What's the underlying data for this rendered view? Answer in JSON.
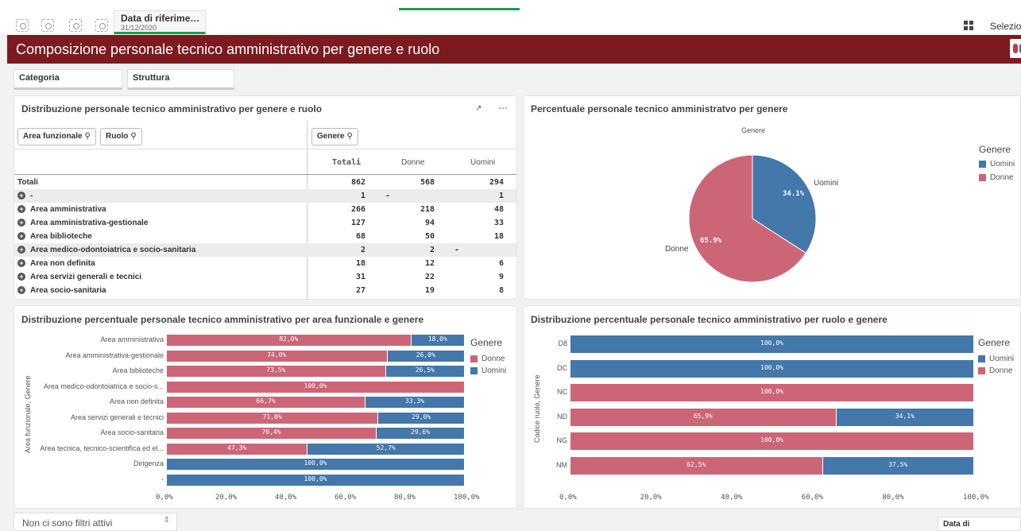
{
  "toolbar": {
    "selection_title": "Data di riferime…",
    "selection_value": "31/12/2020",
    "selections_label": "Selezion"
  },
  "header": {
    "title": "Composizione personale tecnico amministrativo per genere e ruolo"
  },
  "filters": {
    "categoria": "Categoria",
    "struttura": "Struttura"
  },
  "pivot": {
    "title": "Distribuzione personale tecnico amministrativo per genere e ruolo",
    "dim1": "Area funzionale",
    "dim2": "Ruolo",
    "col_dim": "Genere",
    "headers": [
      "Totali",
      "Donne",
      "Uomini"
    ],
    "totals_label": "Totali",
    "totals": [
      "862",
      "568",
      "294"
    ],
    "rows": [
      {
        "label": "-",
        "vals": [
          "1",
          "-",
          "1"
        ]
      },
      {
        "label": "Area amministrativa",
        "vals": [
          "266",
          "218",
          "48"
        ]
      },
      {
        "label": "Area amministrativa-gestionale",
        "vals": [
          "127",
          "94",
          "33"
        ]
      },
      {
        "label": "Area biblioteche",
        "vals": [
          "68",
          "50",
          "18"
        ]
      },
      {
        "label": "Area medico-odontoiatrica e socio-sanitaria",
        "vals": [
          "2",
          "2",
          "-"
        ]
      },
      {
        "label": "Area non definita",
        "vals": [
          "18",
          "12",
          "6"
        ]
      },
      {
        "label": "Area servizi generali e tecnici",
        "vals": [
          "31",
          "22",
          "9"
        ]
      },
      {
        "label": "Area socio-sanitaria",
        "vals": [
          "27",
          "19",
          "8"
        ]
      }
    ]
  },
  "pie": {
    "title": "Percentuale personale tecnico amministratvo per genere",
    "subtitle": "Genere",
    "legend_title": "Genere",
    "legend": [
      "Uomini",
      "Donne"
    ],
    "label_uomini": "Uomini",
    "label_donne": "Donne",
    "pct_uomini": "34.1%",
    "pct_donne": "65.9%"
  },
  "chart_data": [
    {
      "type": "pie",
      "title": "Percentuale personale tecnico amministratvo per genere",
      "slices": [
        {
          "label": "Uomini",
          "value": 34.1,
          "color": "#4477aa"
        },
        {
          "label": "Donne",
          "value": 65.9,
          "color": "#cc6677"
        }
      ]
    },
    {
      "type": "bar",
      "stacked": true,
      "orientation": "horizontal",
      "title": "Distribuzione percentuale personale tecnico amministrativo per area funzionale e genere",
      "ylabel": "Area funzionale, Genere",
      "categories": [
        "Area amministrativa",
        "Area amministrativa-gestionale",
        "Area biblioteche",
        "Area medico-odontoiatrica e socio-s...",
        "Area non definita",
        "Area servizi generali e tecnici",
        "Area socio-sanitaria",
        "Area tecnica, tecnico-scientifica ed el...",
        "Dirigenza",
        "-"
      ],
      "series": [
        {
          "name": "Donne",
          "color": "#cc6677",
          "values": [
            82.0,
            74.0,
            73.5,
            100.0,
            66.7,
            71.0,
            70.4,
            47.3,
            0,
            0
          ]
        },
        {
          "name": "Uomini",
          "color": "#4477aa",
          "values": [
            18.0,
            26.0,
            26.5,
            0,
            33.3,
            29.0,
            29.6,
            52.7,
            100.0,
            100.0
          ]
        }
      ],
      "xlim": [
        0,
        100
      ],
      "ticks": [
        "0,0%",
        "20,0%",
        "40,0%",
        "60,0%",
        "80,0%",
        "100,0%"
      ]
    },
    {
      "type": "bar",
      "stacked": true,
      "orientation": "horizontal",
      "title": "Distribuzione percentuale personale tecnico amministrativo per ruolo e genere",
      "ylabel": "Codice ruolo, Genere",
      "categories": [
        "D8",
        "DC",
        "NC",
        "ND",
        "NG",
        "NM"
      ],
      "series": [
        {
          "name": "Uomini",
          "color": "#4477aa",
          "values": [
            100.0,
            100.0,
            0,
            34.1,
            0,
            37.5
          ]
        },
        {
          "name": "Donne",
          "color": "#cc6677",
          "values": [
            0,
            0,
            100.0,
            65.9,
            100.0,
            62.5
          ]
        }
      ],
      "stack_order": [
        "Donne",
        "Uomini"
      ],
      "xlim": [
        0,
        100
      ],
      "ticks": [
        "0,0%",
        "20,0%",
        "40,0%",
        "60,0%",
        "80,0%",
        "100,0%"
      ]
    }
  ],
  "bar1": {
    "legend_title": "Genere",
    "legend": [
      "Donne",
      "Uomini"
    ]
  },
  "bar2": {
    "legend_title": "Genere",
    "legend": [
      "Uomini",
      "Donne"
    ]
  },
  "footer": {
    "filter_text": "Non ci sono filtri attivi",
    "date_label": "Data di"
  }
}
